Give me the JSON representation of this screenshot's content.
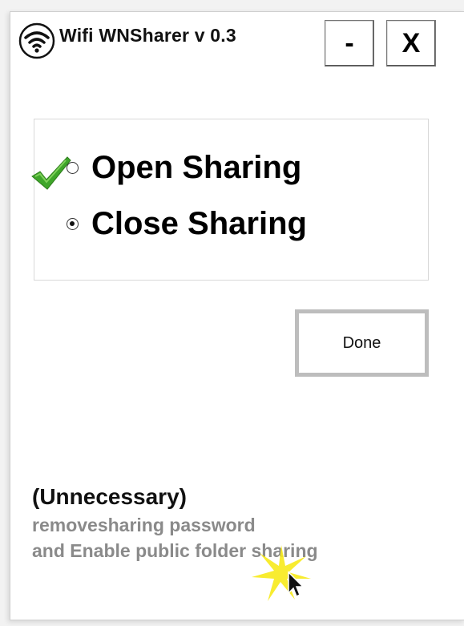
{
  "window": {
    "title": "Wifi WNSharer v 0.3",
    "icon": "wifi-icon"
  },
  "controls": {
    "minimize_label": "-",
    "close_label": "X"
  },
  "sharing_options": {
    "open_label": "Open Sharing",
    "close_label": "Close Sharing",
    "selected": "Close Sharing",
    "status_icon": "checkmark-icon"
  },
  "actions": {
    "done_label": "Done"
  },
  "footer": {
    "title": "(Unnecessary)",
    "line1": "removesharing password",
    "line2": "and Enable public folder sharing"
  },
  "colors": {
    "accent_check": "#4caf1f",
    "cursor_highlight": "#f5e616"
  }
}
